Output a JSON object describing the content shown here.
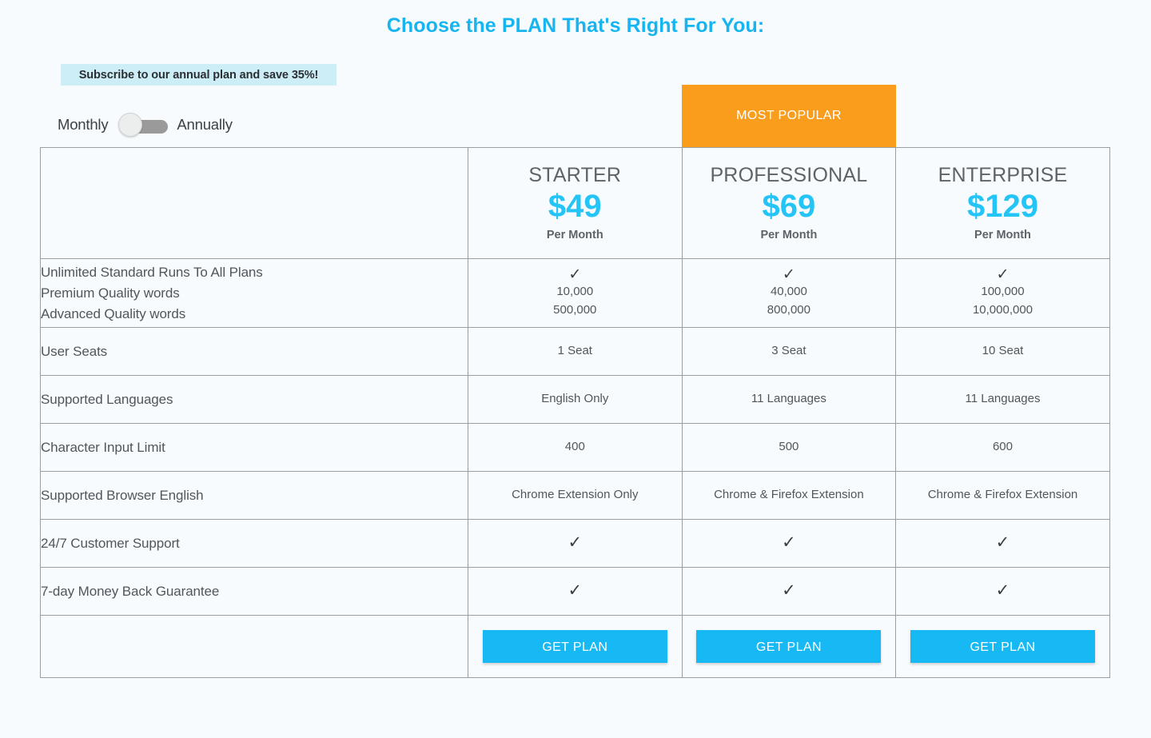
{
  "header": {
    "title": "Choose the PLAN That's Right For You:"
  },
  "promo": {
    "text": "Subscribe to our annual plan and save 35%!"
  },
  "billing_toggle": {
    "left_label": "Monthly",
    "right_label": "Annually",
    "selected": "Monthly",
    "track_color": "#9a9a9a",
    "knob_color": "#eceded"
  },
  "popular_ribbon": {
    "label": "MOST POPULAR",
    "color": "#fa9d1c",
    "applies_to": "PROFESSIONAL"
  },
  "plans": [
    {
      "name": "STARTER",
      "price": "$49",
      "period": "Per Month",
      "cta": "GET PLAN"
    },
    {
      "name": "PROFESSIONAL",
      "price": "$69",
      "period": "Per Month",
      "cta": "GET PLAN"
    },
    {
      "name": "ENTERPRISE",
      "price": "$129",
      "period": "Per Month",
      "cta": "GET PLAN"
    }
  ],
  "features": [
    {
      "label_lines": [
        "Unlimited Standard Runs To All Plans",
        "Premium Quality words",
        "Advanced Quality words"
      ],
      "values": [
        [
          "✓",
          "10,000",
          "500,000"
        ],
        [
          "✓",
          "40,000",
          "800,000"
        ],
        [
          "✓",
          "100,000",
          "10,000,000"
        ]
      ]
    },
    {
      "label_lines": [
        "User Seats"
      ],
      "values": [
        [
          "1 Seat"
        ],
        [
          "3 Seat"
        ],
        [
          "10 Seat"
        ]
      ]
    },
    {
      "label_lines": [
        "Supported Languages"
      ],
      "values": [
        [
          "English Only"
        ],
        [
          "11 Languages"
        ],
        [
          "11 Languages"
        ]
      ]
    },
    {
      "label_lines": [
        "Character Input Limit"
      ],
      "values": [
        [
          "400"
        ],
        [
          "500"
        ],
        [
          "600"
        ]
      ]
    },
    {
      "label_lines": [
        "Supported Browser English"
      ],
      "values": [
        [
          "Chrome Extension Only"
        ],
        [
          "Chrome & Firefox Extension"
        ],
        [
          "Chrome & Firefox Extension"
        ]
      ]
    },
    {
      "label_lines": [
        "24/7 Customer Support"
      ],
      "values": [
        [
          "✓"
        ],
        [
          "✓"
        ],
        [
          "✓"
        ]
      ]
    },
    {
      "label_lines": [
        "7-day Money Back Guarantee"
      ],
      "values": [
        [
          "✓"
        ],
        [
          "✓"
        ],
        [
          "✓"
        ]
      ]
    }
  ],
  "colors": {
    "accent_cyan": "#25c4f7",
    "title_cyan": "#17b5f0",
    "button_blue": "#16b9f3",
    "promo_bg": "#cdedf7",
    "orange": "#fa9d1c",
    "page_bg": "#f8fbfd",
    "border": "#9b9fa3"
  }
}
